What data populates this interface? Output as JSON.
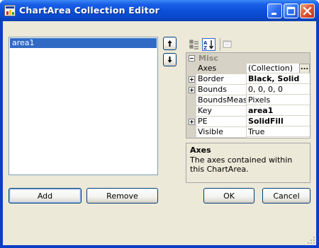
{
  "window": {
    "title": "ChartArea Collection Editor",
    "icons": {
      "app": "chart-app-icon",
      "minimize": "minimize-icon",
      "maximize": "maximize-icon",
      "close": "close-icon"
    }
  },
  "members": {
    "items": [
      "area1"
    ],
    "selected": "area1",
    "move_up_icon": "arrow-up-icon",
    "move_down_icon": "arrow-down-icon"
  },
  "toolbar": {
    "categorized_icon": "categorized-icon",
    "alphabetical_icon": "alphabetical-sort-icon",
    "property_pages_icon": "property-pages-icon"
  },
  "property_grid": {
    "category": "Misc",
    "rows": [
      {
        "name": "Axes",
        "value": "(Collection)",
        "bold": false,
        "expandable": false,
        "selected": true,
        "has_ellipsis": true
      },
      {
        "name": "Border",
        "value": "Black, Solid",
        "bold": true,
        "expandable": true
      },
      {
        "name": "Bounds",
        "value": "0, 0, 0, 0",
        "bold": false,
        "expandable": true
      },
      {
        "name": "BoundsMeasu",
        "value": "Pixels",
        "bold": false,
        "expandable": false
      },
      {
        "name": "Key",
        "value": "area1",
        "bold": true,
        "expandable": false
      },
      {
        "name": "PE",
        "value": "SolidFill",
        "bold": true,
        "expandable": true
      },
      {
        "name": "Visible",
        "value": "True",
        "bold": false,
        "expandable": false
      }
    ],
    "ellipsis_label": "..."
  },
  "help": {
    "title": "Axes",
    "description": "The axes contained within this ChartArea."
  },
  "buttons": {
    "add": "Add",
    "remove": "Remove",
    "ok": "OK",
    "cancel": "Cancel"
  },
  "colors": {
    "title_bar": "#0a46c8",
    "selection": "#316ac5",
    "client_bg": "#ece9d8"
  }
}
